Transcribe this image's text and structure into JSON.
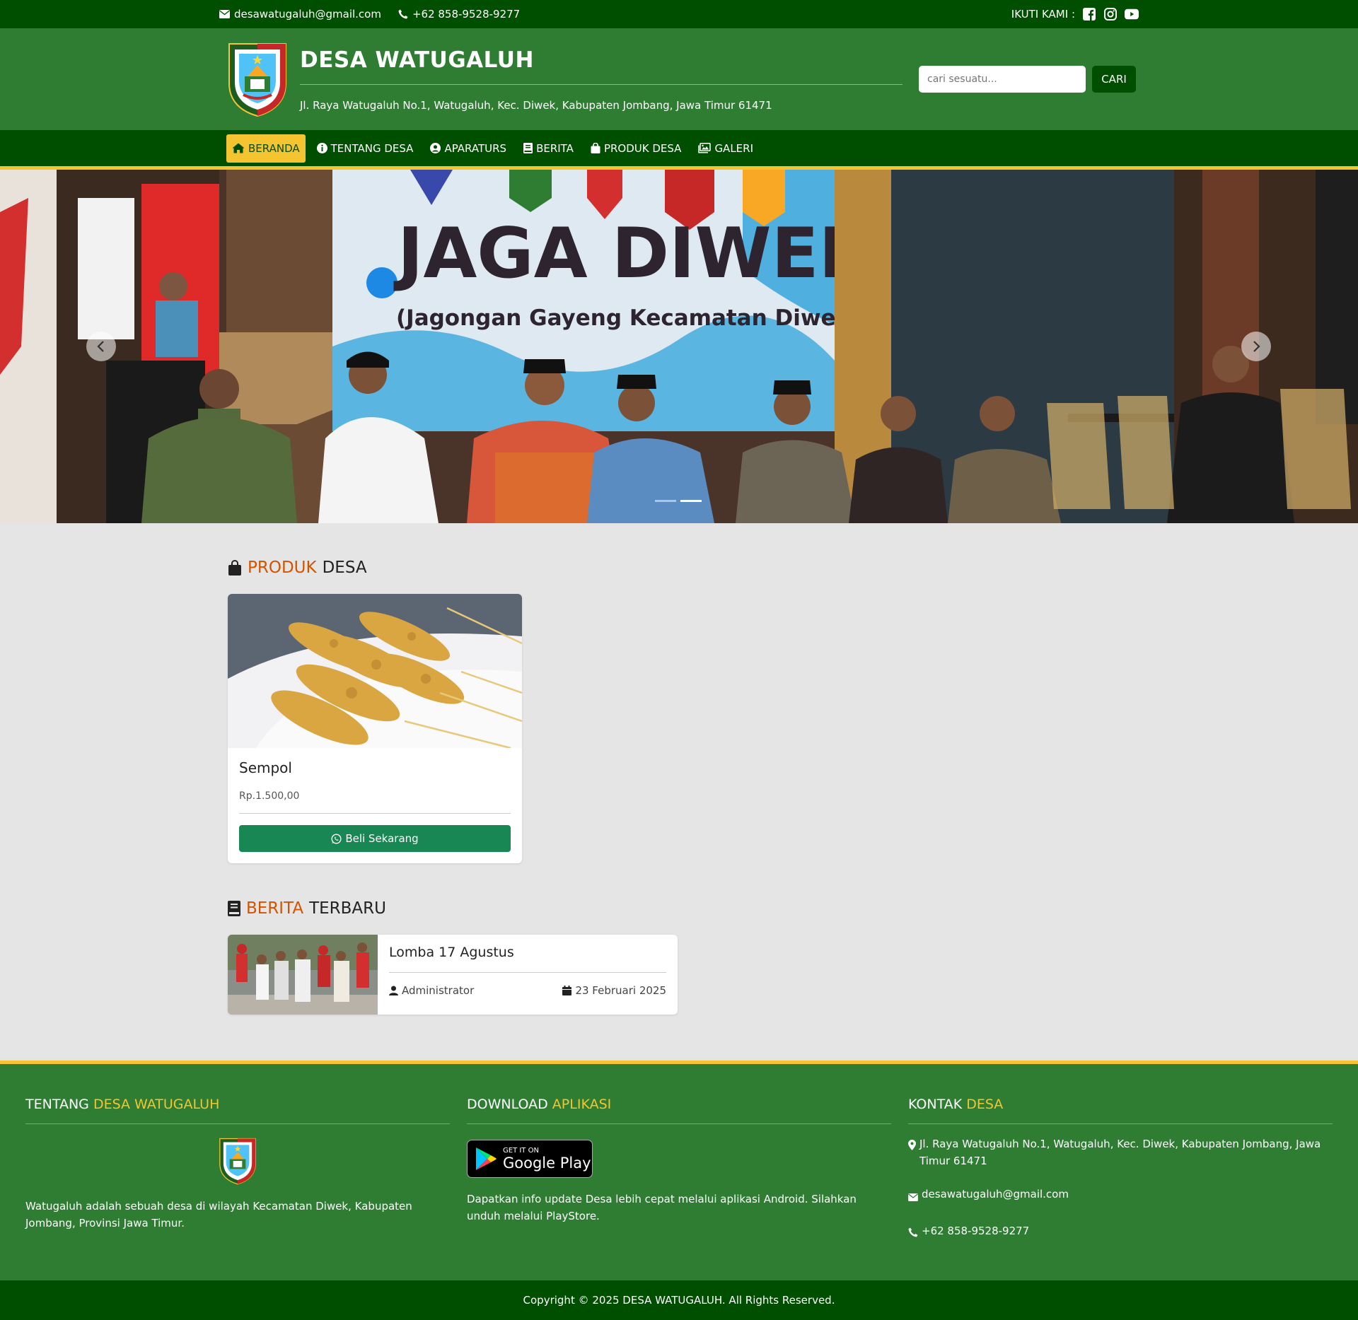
{
  "topbar": {
    "email": "desawatugaluh@gmail.com",
    "phone": "+62 858-9528-9277",
    "follow_label": "IKUTI KAMI :"
  },
  "header": {
    "title": "DESA WATUGALUH",
    "address": "Jl. Raya Watugaluh No.1, Watugaluh, Kec. Diwek, Kabupaten Jombang, Jawa Timur 61471",
    "search_placeholder": "cari sesuatu...",
    "search_button": "CARI"
  },
  "nav": {
    "items": [
      {
        "label": "BERANDA",
        "icon": "home-icon",
        "active": true
      },
      {
        "label": "TENTANG DESA",
        "icon": "info-icon",
        "active": false
      },
      {
        "label": "APARATURS",
        "icon": "user-circle-icon",
        "active": false
      },
      {
        "label": "BERITA",
        "icon": "book-icon",
        "active": false
      },
      {
        "label": "PRODUK DESA",
        "icon": "shopping-bag-icon",
        "active": false
      },
      {
        "label": "GALERI",
        "icon": "images-icon",
        "active": false
      }
    ]
  },
  "hero": {
    "banner_title": "JAGA DIWEK",
    "banner_subtitle": "(Jagongan Gayeng Kecamatan Diwek)",
    "slide_count": 2,
    "active_slide": 2
  },
  "products": {
    "title_highlight": "PRODUK",
    "title_rest": "DESA",
    "items": [
      {
        "name": "Sempol",
        "price": "Rp.1.500,00",
        "button": "Beli Sekarang"
      }
    ]
  },
  "news": {
    "title_highlight": "BERITA",
    "title_rest": "TERBARU",
    "items": [
      {
        "title": "Lomba 17 Agustus",
        "author": "Administrator",
        "date": "23 Februari 2025"
      }
    ]
  },
  "footer": {
    "about": {
      "title_prefix": "TENTANG",
      "title_highlight": "DESA WATUGALUH",
      "text": "Watugaluh adalah sebuah desa di wilayah Kecamatan Diwek, Kabupaten Jombang, Provinsi Jawa Timur."
    },
    "download": {
      "title_prefix": "DOWNLOAD",
      "title_highlight": "APLIKASI",
      "badge_small": "GET IT ON",
      "badge_big": "Google Play",
      "text": "Dapatkan info update Desa lebih cepat melalui aplikasi Android. Silahkan unduh melalui PlayStore."
    },
    "contact": {
      "title_prefix": "KONTAK",
      "title_highlight": "DESA",
      "address": "Jl. Raya Watugaluh No.1, Watugaluh, Kec. Diwek, Kabupaten Jombang, Jawa Timur 61471",
      "email": "desawatugaluh@gmail.com",
      "phone": "+62 858-9528-9277"
    }
  },
  "copyright": "Copyright © 2025 DESA WATUGALUH. All Rights Reserved.",
  "colors": {
    "dark_green": "#004f00",
    "green": "#2e7d32",
    "yellow": "#f4c431",
    "orange_highlight": "#d35400",
    "button_green": "#198754"
  }
}
